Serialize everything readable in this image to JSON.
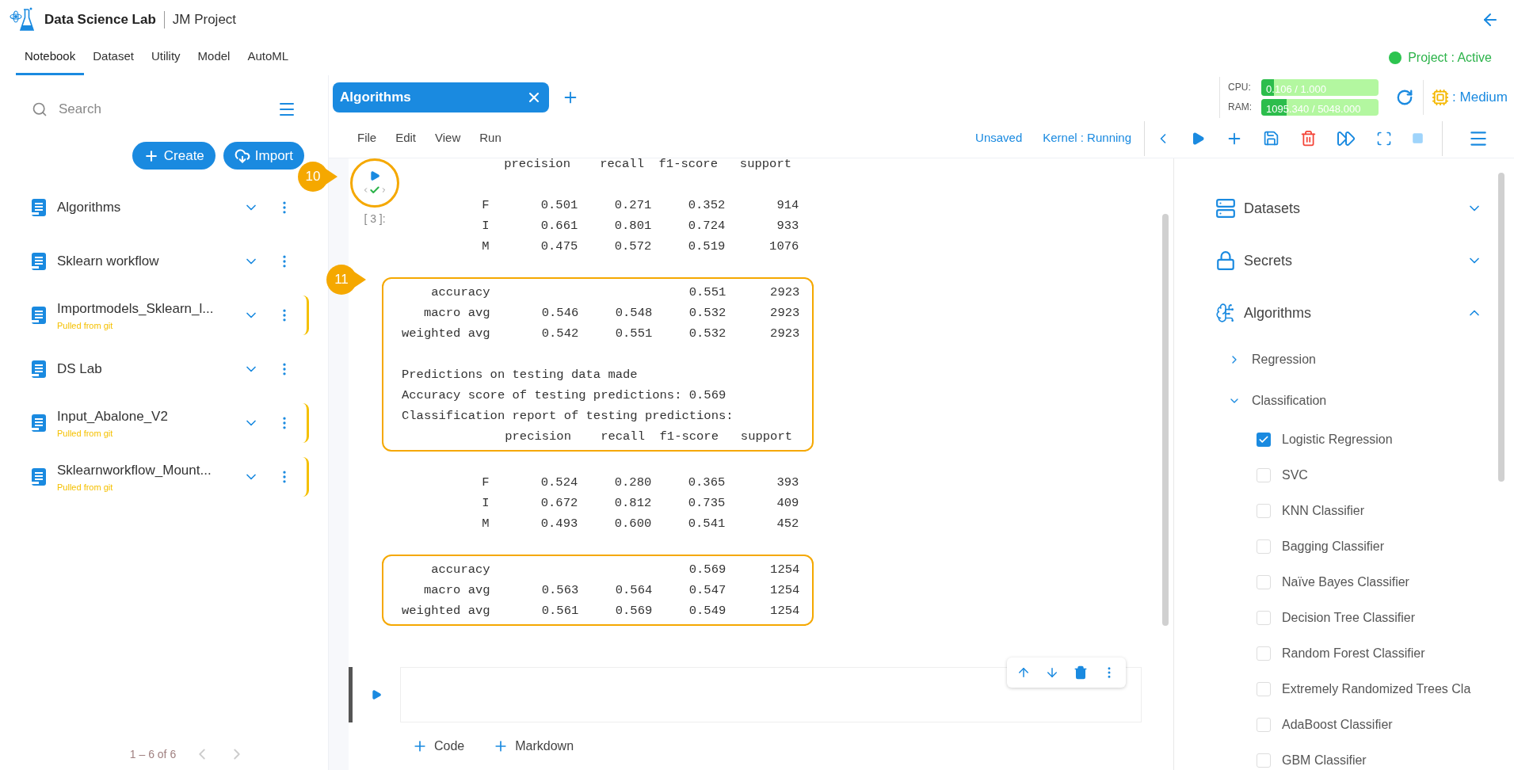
{
  "app": {
    "name": "Data Science Lab",
    "project": "JM Project",
    "status": "Project : Active",
    "active": true
  },
  "nav_tabs": [
    {
      "label": "Notebook",
      "selected": true
    },
    {
      "label": "Dataset",
      "selected": false
    },
    {
      "label": "Utility",
      "selected": false
    },
    {
      "label": "Model",
      "selected": false
    },
    {
      "label": "AutoML",
      "selected": false
    }
  ],
  "sidebar": {
    "search_placeholder": "Search",
    "buttons": [
      {
        "label": "Create",
        "kind": "create"
      },
      {
        "label": "Import",
        "kind": "import"
      }
    ],
    "notebooks": [
      {
        "name": "Algorithms"
      },
      {
        "name": "Sklearn workflow"
      },
      {
        "name": "Importmodels_Sklearn_l...",
        "source": "Pulled from git"
      },
      {
        "name": "DS Lab"
      },
      {
        "name": "Input_Abalone_V2",
        "source": "Pulled from git"
      },
      {
        "name": "Sklearnworkflow_Mount...",
        "source": "Pulled from git"
      }
    ],
    "pager": {
      "text": "1 – 6 of 6",
      "prev_disabled": true,
      "next_disabled": true
    }
  },
  "notebook_tabs": [
    {
      "label": "Algorithms",
      "selected": true
    }
  ],
  "resources": {
    "cpu": {
      "label": "CPU:",
      "reading": "0.106 / 1.000",
      "level": 0.106
    },
    "ram": {
      "label": "RAM:",
      "reading": "1095.340 / 5048.000",
      "level": 0.217
    },
    "instance": ": Medium"
  },
  "menu": [
    "File",
    "Edit",
    "View",
    "Run"
  ],
  "status": {
    "save": "Unsaved",
    "kernel": "Kernel : Running"
  },
  "cell": {
    "prompt": "[ 3 ]:",
    "callout": "10",
    "output": [
      {
        "highlighted": false,
        "paragraphs": [
          [
            "              precision    recall  f1-score   support"
          ],
          [
            "           F       0.501     0.271     0.352       914",
            "           I       0.661     0.801     0.724       933",
            "           M       0.475     0.572     0.519      1076"
          ]
        ]
      },
      {
        "highlighted": true,
        "callout": "11",
        "paragraphs": [
          [
            "    accuracy                           0.551      2923",
            "   macro avg       0.546     0.548     0.532      2923",
            "weighted avg       0.542     0.551     0.532      2923"
          ],
          [
            "Predictions on testing data made",
            "Accuracy score of testing predictions: 0.569",
            "Classification report of testing predictions:",
            "              precision    recall  f1-score   support"
          ]
        ]
      },
      {
        "highlighted": false,
        "paragraphs": [
          [
            "           F       0.524     0.280     0.365       393",
            "           I       0.672     0.812     0.735       409",
            "           M       0.493     0.600     0.541       452"
          ]
        ]
      },
      {
        "highlighted": true,
        "paragraphs": [
          [
            "    accuracy                           0.569      1254",
            "   macro avg       0.563     0.564     0.547      1254",
            "weighted avg       0.561     0.569     0.549      1254"
          ]
        ]
      }
    ]
  },
  "new_cell": {
    "add_buttons": [
      "Code",
      "Markdown"
    ]
  },
  "right_panel": {
    "sections": [
      {
        "label": "Datasets",
        "kind": "datasets",
        "expanded": false
      },
      {
        "label": "Secrets",
        "kind": "secrets",
        "expanded": false
      },
      {
        "label": "Algorithms",
        "kind": "algorithms",
        "expanded": true,
        "children": [
          {
            "label": "Regression",
            "expanded": false
          },
          {
            "label": "Classification",
            "expanded": true,
            "children": [
              {
                "label": "Logistic Regression",
                "checked": true
              },
              {
                "label": "SVC",
                "checked": false
              },
              {
                "label": "KNN Classifier",
                "checked": false
              },
              {
                "label": "Bagging Classifier",
                "checked": false
              },
              {
                "label": "Naïve Bayes Classifier",
                "checked": false
              },
              {
                "label": "Decision Tree Classifier",
                "checked": false
              },
              {
                "label": "Random Forest Classifier",
                "checked": false
              },
              {
                "label": "Extremely Randomized Trees Cla",
                "checked": false
              },
              {
                "label": "AdaBoost Classifier",
                "checked": false
              },
              {
                "label": "GBM Classifier",
                "checked": false
              }
            ]
          }
        ]
      }
    ]
  }
}
